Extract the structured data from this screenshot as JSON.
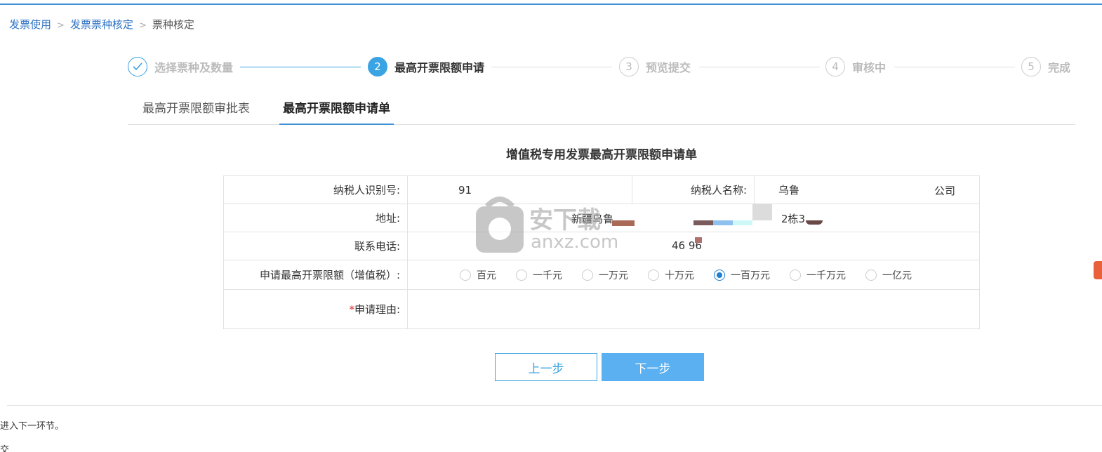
{
  "breadcrumb": {
    "items": [
      "发票使用",
      "发票票种核定"
    ],
    "separator": ">",
    "current": "票种核定"
  },
  "steps": [
    {
      "number": "✓",
      "label": "选择票种及数量",
      "state": "done"
    },
    {
      "number": "2",
      "label": "最高开票限额申请",
      "state": "active"
    },
    {
      "number": "3",
      "label": "预览提交",
      "state": "pending"
    },
    {
      "number": "4",
      "label": "审核中",
      "state": "pending"
    },
    {
      "number": "5",
      "label": "完成",
      "state": "pending"
    }
  ],
  "tabs": [
    {
      "label": "最高开票限额审批表",
      "active": false
    },
    {
      "label": "最高开票限额申请单",
      "active": true
    }
  ],
  "form": {
    "title": "增值税专用发票最高开票限额申请单",
    "taxpayer_id_label": "纳税人识别号:",
    "taxpayer_id_value": "91",
    "taxpayer_name_label": "纳税人名称:",
    "taxpayer_name_value": "乌鲁",
    "taxpayer_name_suffix": "公司",
    "address_label": "地址:",
    "address_value": "新疆乌鲁",
    "address_suffix": "2栋3",
    "phone_label": "联系电话:",
    "phone_value": "46  96",
    "limit_label": "申请最高开票限额（增值税）:",
    "limit_options": [
      "百元",
      "一千元",
      "一万元",
      "十万元",
      "一百万元",
      "一千万元",
      "一亿元"
    ],
    "limit_selected": "一百万元",
    "reason_required_mark": "*",
    "reason_label": "申请理由:"
  },
  "buttons": {
    "prev": "上一步",
    "next": "下一步"
  },
  "footer": {
    "line1": "进入下一环节。",
    "line2": "交"
  },
  "watermark": {
    "text_cn": "安下载",
    "text_en": "anxz.com"
  },
  "colors": {
    "accent": "#3aa3e3",
    "link": "#2d73c4",
    "required": "#e02020",
    "primary_button": "#5ab0f0"
  }
}
